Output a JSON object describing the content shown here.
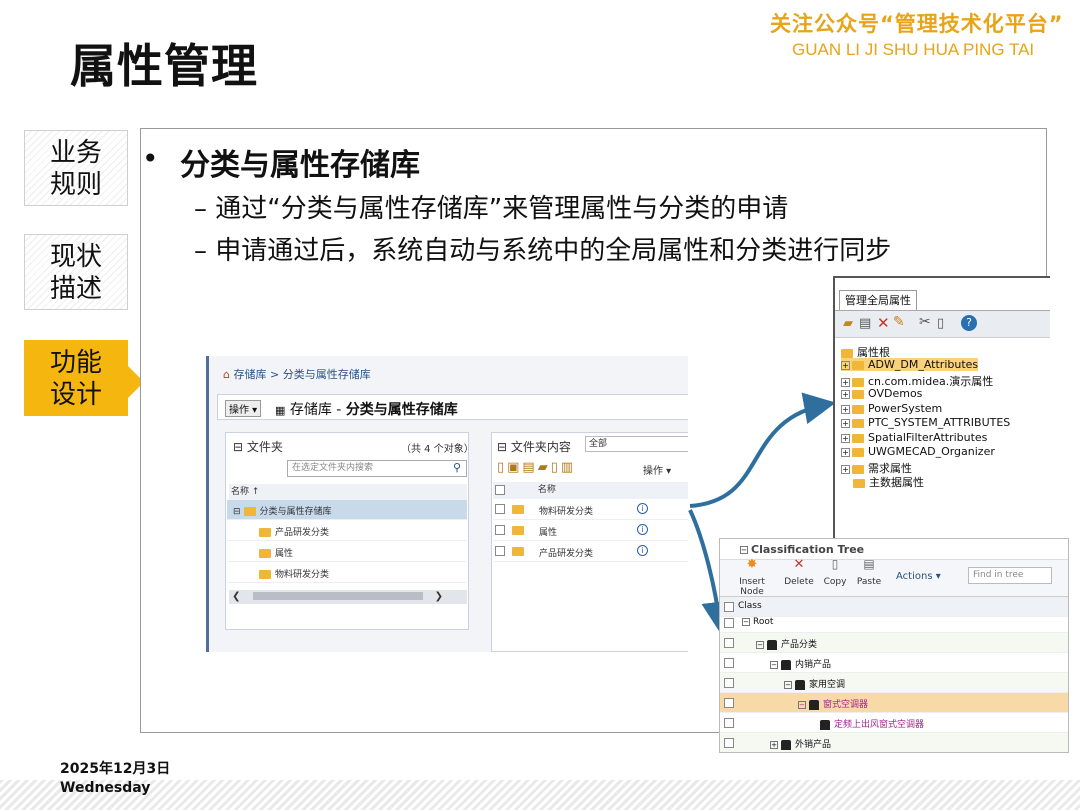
{
  "header": {
    "title": "属性管理",
    "brand_cn": "关注公众号“管理技术化平台”",
    "brand_en": "GUAN LI JI SHU HUA PING TAI"
  },
  "nav": {
    "items": [
      {
        "line1": "业务",
        "line2": "规则"
      },
      {
        "line1": "现状",
        "line2": "描述"
      },
      {
        "line1": "功能",
        "line2": "设计"
      }
    ],
    "active_index": 2
  },
  "content": {
    "bullet": "分类与属性存储库",
    "subs": [
      "– 通过“分类与属性存储库”来管理属性与分类的申请",
      "– 申请通过后，系统自动与系统中的全局属性和分类进行同步"
    ]
  },
  "repo_window": {
    "breadcrumb": "存储库 > 分类与属性存储库",
    "ops_label": "操作 ▾",
    "heading_prefix": "存储库 - ",
    "heading": "分类与属性存储库",
    "folder_panel": {
      "title": "文件夹",
      "count": "（共 4 个对象）",
      "search_placeholder": "在选定文件夹内搜索",
      "col_name": "名称 ↑",
      "root": "分类与属性存储库",
      "children": [
        "产品研发分类",
        "属性",
        "物料研发分类"
      ]
    },
    "content_panel": {
      "title": "文件夹内容",
      "filter": "全部",
      "ops_label": "操作 ▾",
      "col_name": "名称",
      "rows": [
        "物料研发分类",
        "属性",
        "产品研发分类"
      ]
    }
  },
  "attr_window": {
    "tab": "管理全局属性",
    "root": "属性根",
    "items": [
      "ADW_DM_Attributes",
      "cn.com.midea.演示属性",
      "OVDemos",
      "PowerSystem",
      "PTC_SYSTEM_ATTRIBUTES",
      "SpatialFilterAttributes",
      "UWGMECAD_Organizer",
      "需求属性",
      "主数据属性"
    ],
    "selected_index": 0
  },
  "class_window": {
    "title": "Classification Tree",
    "buttons": [
      "Insert Node",
      "Delete",
      "Copy",
      "Paste"
    ],
    "actions_label": "Actions ▾",
    "find_placeholder": "Find in tree",
    "col_class": "Class",
    "rows": [
      "Root",
      "产品分类",
      "内销产品",
      "家用空调",
      "窗式空调器",
      "定频上出风窗式空调器",
      "外销产品"
    ],
    "selected_index": 4
  },
  "footer": {
    "date": "2025年12月3日",
    "day": "Wednesday"
  },
  "colors": {
    "accent": "#f5b70f",
    "brand": "#e7a418",
    "link_blue": "#2a4f86",
    "arrow": "#2e6f9e"
  }
}
